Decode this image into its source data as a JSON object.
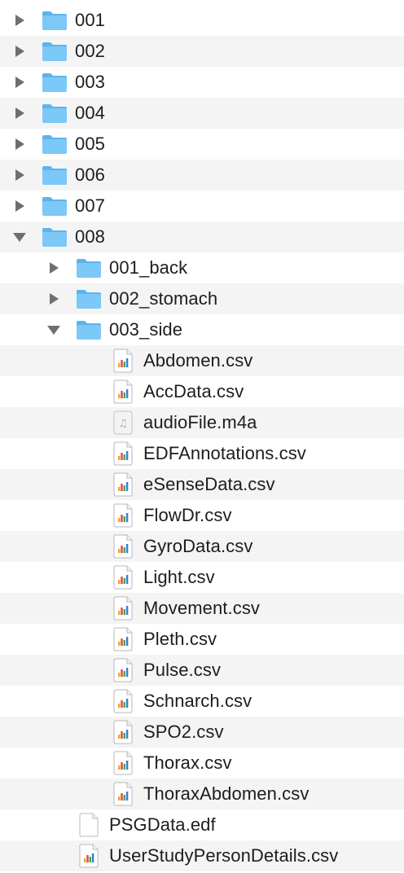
{
  "file_tree": [
    {
      "name": "001",
      "type": "folder",
      "depth": 0,
      "expanded": false
    },
    {
      "name": "002",
      "type": "folder",
      "depth": 0,
      "expanded": false
    },
    {
      "name": "003",
      "type": "folder",
      "depth": 0,
      "expanded": false
    },
    {
      "name": "004",
      "type": "folder",
      "depth": 0,
      "expanded": false
    },
    {
      "name": "005",
      "type": "folder",
      "depth": 0,
      "expanded": false
    },
    {
      "name": "006",
      "type": "folder",
      "depth": 0,
      "expanded": false
    },
    {
      "name": "007",
      "type": "folder",
      "depth": 0,
      "expanded": false
    },
    {
      "name": "008",
      "type": "folder",
      "depth": 0,
      "expanded": true
    },
    {
      "name": "001_back",
      "type": "folder",
      "depth": 1,
      "expanded": false
    },
    {
      "name": "002_stomach",
      "type": "folder",
      "depth": 1,
      "expanded": false
    },
    {
      "name": "003_side",
      "type": "folder",
      "depth": 1,
      "expanded": true
    },
    {
      "name": "Abdomen.csv",
      "type": "csv",
      "depth": 2
    },
    {
      "name": "AccData.csv",
      "type": "csv",
      "depth": 2
    },
    {
      "name": "audioFile.m4a",
      "type": "audio",
      "depth": 2
    },
    {
      "name": "EDFAnnotations.csv",
      "type": "csv",
      "depth": 2
    },
    {
      "name": "eSenseData.csv",
      "type": "csv",
      "depth": 2
    },
    {
      "name": "FlowDr.csv",
      "type": "csv",
      "depth": 2
    },
    {
      "name": "GyroData.csv",
      "type": "csv",
      "depth": 2
    },
    {
      "name": "Light.csv",
      "type": "csv",
      "depth": 2
    },
    {
      "name": "Movement.csv",
      "type": "csv",
      "depth": 2
    },
    {
      "name": "Pleth.csv",
      "type": "csv",
      "depth": 2
    },
    {
      "name": "Pulse.csv",
      "type": "csv",
      "depth": 2
    },
    {
      "name": "Schnarch.csv",
      "type": "csv",
      "depth": 2
    },
    {
      "name": "SPO2.csv",
      "type": "csv",
      "depth": 2
    },
    {
      "name": "Thorax.csv",
      "type": "csv",
      "depth": 2
    },
    {
      "name": "ThoraxAbdomen.csv",
      "type": "csv",
      "depth": 2
    },
    {
      "name": "PSGData.edf",
      "type": "document",
      "depth": 1
    },
    {
      "name": "UserStudyPersonDetails.csv",
      "type": "csv",
      "depth": 1
    }
  ],
  "colors": {
    "folder_body": "#7cc8f7",
    "folder_tab": "#5ab4ef",
    "text": "#1d1d1f",
    "alternate_row": "#f4f4f5",
    "disclosure": "#6f6f6f"
  }
}
